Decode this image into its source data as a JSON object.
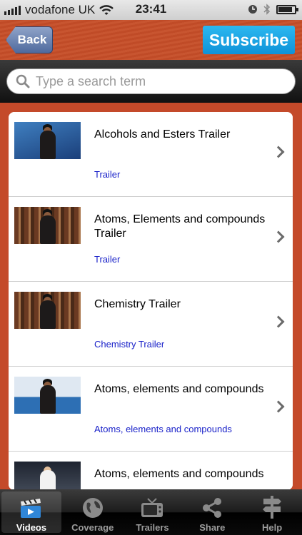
{
  "status_bar": {
    "carrier": "vodafone UK",
    "time": "23:41",
    "battery_level": 0.85
  },
  "nav": {
    "back_label": "Back",
    "subscribe_label": "Subscribe"
  },
  "search": {
    "placeholder": "Type a search term",
    "value": ""
  },
  "items": [
    {
      "title": "Alcohols and Esters Trailer",
      "subtitle": "Trailer",
      "thumb": "blue-studio"
    },
    {
      "title": "Atoms, Elements and compounds Trailer",
      "subtitle": "Trailer",
      "thumb": "library"
    },
    {
      "title": "Chemistry Trailer",
      "subtitle": "Chemistry Trailer",
      "thumb": "library"
    },
    {
      "title": "Atoms, elements and compounds",
      "subtitle": "Atoms, elements and compounds",
      "thumb": "blue-screens"
    },
    {
      "title": "Atoms, elements and compounds",
      "subtitle": "",
      "thumb": "lab"
    }
  ],
  "tabs": [
    {
      "label": "Videos",
      "icon": "clapperboard-icon",
      "active": true
    },
    {
      "label": "Coverage",
      "icon": "globe-icon",
      "active": false
    },
    {
      "label": "Trailers",
      "icon": "tv-icon",
      "active": false
    },
    {
      "label": "Share",
      "icon": "share-icon",
      "active": false
    },
    {
      "label": "Help",
      "icon": "signpost-icon",
      "active": false
    }
  ],
  "colors": {
    "accent_blue": "#1b9fe3",
    "link_blue": "#1a22c9",
    "nav_red": "#c44a2a"
  }
}
